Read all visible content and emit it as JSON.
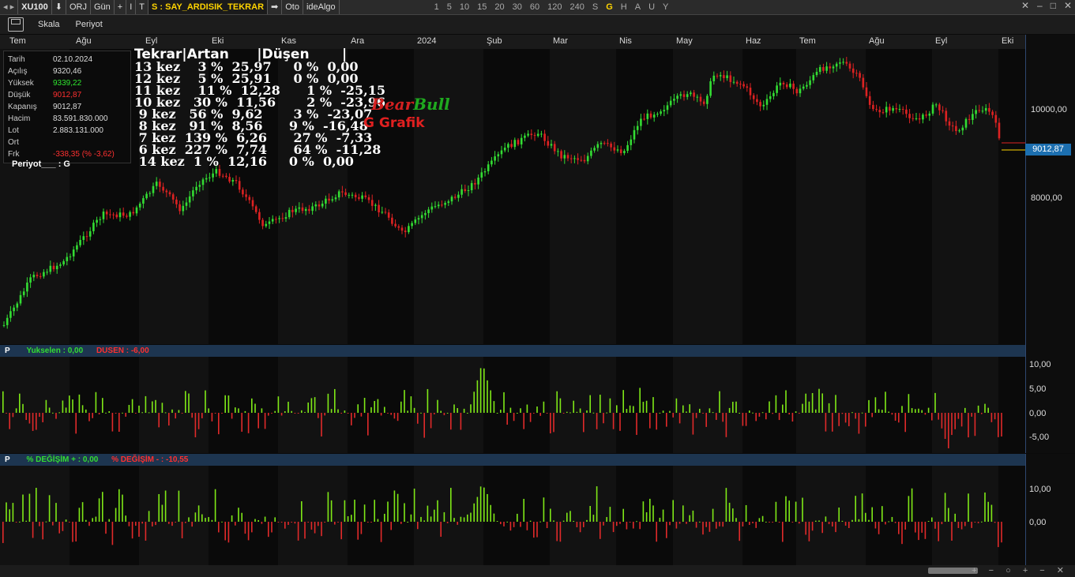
{
  "toolbar": {
    "symbol": "XU100",
    "arrow": "⬇",
    "orj": "ORJ",
    "interval": "Gün",
    "plus": "+",
    "i": "I",
    "t": "T",
    "formula": "S : SAY_ARDISIK_TEKRAR",
    "go": "➡",
    "oto": "Oto",
    "idealgo": "ideAlgo",
    "periods": [
      "1",
      "5",
      "10",
      "15",
      "20",
      "30",
      "60",
      "120",
      "240",
      "S",
      "G",
      "H",
      "A",
      "U",
      "Y"
    ],
    "active_period": "G"
  },
  "toolbar2": {
    "scale": "Skala",
    "period": "Periyot"
  },
  "time_axis": [
    "Tem",
    "Ağu",
    "Eyl",
    "Eki",
    "Kas",
    "Ara",
    "2024",
    "Şub",
    "Mar",
    "Nis",
    "May",
    "Haz",
    "Tem",
    "Ağu",
    "Eyl",
    "Eki"
  ],
  "price_axis": [
    "10000,00",
    "8000,00"
  ],
  "last_price": "9012,87",
  "info": {
    "rows": [
      {
        "k": "Tarih",
        "v": "02.10.2024",
        "color": "#dddddd"
      },
      {
        "k": "Açılış",
        "v": "9320,46",
        "color": "#dddddd"
      },
      {
        "k": "Yüksek",
        "v": "9339,22",
        "color": "#2ee82e"
      },
      {
        "k": "Düşük",
        "v": "9012,87",
        "color": "#ff3030"
      },
      {
        "k": "Kapanış",
        "v": "9012,87",
        "color": "#dddddd"
      },
      {
        "k": "Hacim",
        "v": "83.591.830.000",
        "color": "#dddddd"
      },
      {
        "k": "Lot",
        "v": "2.883.131.000",
        "color": "#dddddd"
      },
      {
        "k": "Ort",
        "v": "",
        "color": "#dddddd"
      },
      {
        "k": "Frk",
        "v": "-338,35 (% -3,62)",
        "color": "#ff3030"
      }
    ],
    "period_line": "Periyot___ : G"
  },
  "stats": {
    "header": "Tekrar|Artan      |Düşen       |",
    "lines": [
      "13 kez    3 %  25,97     0 %  0,00",
      "12 kez    5 %  25,91     0 %  0,00",
      "11 kez    11 %  12,28      1 %  -25,15",
      "10 kez   30 %  11,56       2 %  -23,96",
      " 9 kez   56 %  9,62       3 %  -23,07",
      " 8 kez   91 %  8,56      9 %  -16,48",
      " 7 kez  139 %  6,26      27 %  -7,33",
      " 6 kez  227 %  7,74      64 %  -11,28",
      " 14 kez  1 %  12,16     0 %  0,00"
    ]
  },
  "brand": {
    "bear": "Bear",
    "bull": "Bull",
    "grafik": "G  Grafik"
  },
  "panel1": {
    "p": "P",
    "up_label": "Yukselen :  0,00",
    "down_label": "DUSEN :  -6,00",
    "axis": [
      "10,00",
      "5,00",
      "0,00",
      "-5,00"
    ]
  },
  "panel2": {
    "p": "P",
    "up_label": "% DEĞİŞİM + :  0,00",
    "down_label": "% DEĞİŞİM - :  -10,55",
    "axis": [
      "10,00",
      "0,00"
    ]
  },
  "colors": {
    "up": "#33dd33",
    "down": "#dd2222",
    "axis_border": "#2f4870",
    "accent": "#ffd400"
  }
}
